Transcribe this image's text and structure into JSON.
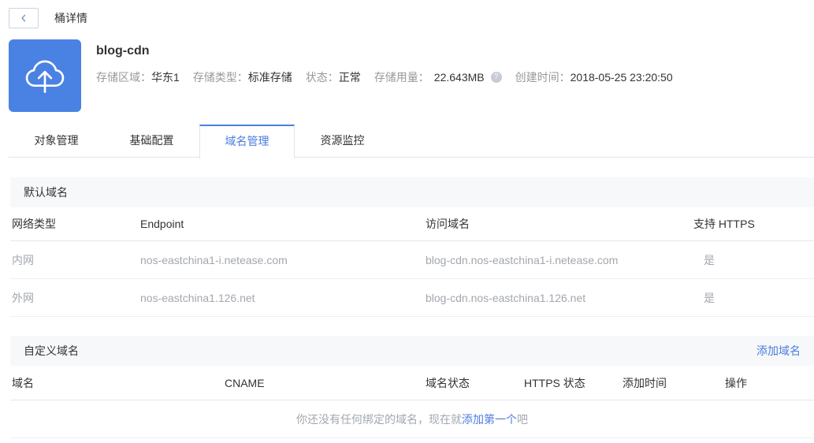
{
  "header": {
    "title": "桶详情"
  },
  "bucket": {
    "name": "blog-cdn",
    "fields": [
      {
        "label": "存储区域：",
        "value": "华东1"
      },
      {
        "label": "存储类型：",
        "value": "标准存储"
      },
      {
        "label": "状态：",
        "value": "正常"
      },
      {
        "label": "存储用量：",
        "value": "22.643MB"
      },
      {
        "label": "创建时间：",
        "value": "2018-05-25 23:20:50"
      }
    ],
    "help_icon_glyph": "?"
  },
  "tabs": [
    {
      "label": "对象管理"
    },
    {
      "label": "基础配置"
    },
    {
      "label": "域名管理"
    },
    {
      "label": "资源监控"
    }
  ],
  "active_tab": "域名管理",
  "default_domain": {
    "title": "默认域名",
    "columns": [
      "网络类型",
      "Endpoint",
      "访问域名",
      "支持 HTTPS"
    ],
    "rows": [
      {
        "network": "内网",
        "endpoint": "nos-eastchina1-i.netease.com",
        "domain": "blog-cdn.nos-eastchina1-i.netease.com",
        "https": "是"
      },
      {
        "network": "外网",
        "endpoint": "nos-eastchina1.126.net",
        "domain": "blog-cdn.nos-eastchina1.126.net",
        "https": "是"
      }
    ]
  },
  "custom_domain": {
    "title": "自定义域名",
    "add_link_label": "添加域名",
    "columns": [
      "域名",
      "CNAME",
      "域名状态",
      "HTTPS 状态",
      "添加时间",
      "操作"
    ],
    "empty_prefix": "你还没有任何绑定的域名，现在就",
    "empty_link": "添加第一个",
    "empty_suffix": "吧"
  },
  "colors": {
    "accent": "#4b7ce0",
    "icon_blue": "#4a82e4",
    "section_bar_bg": "#f7f8fa"
  }
}
